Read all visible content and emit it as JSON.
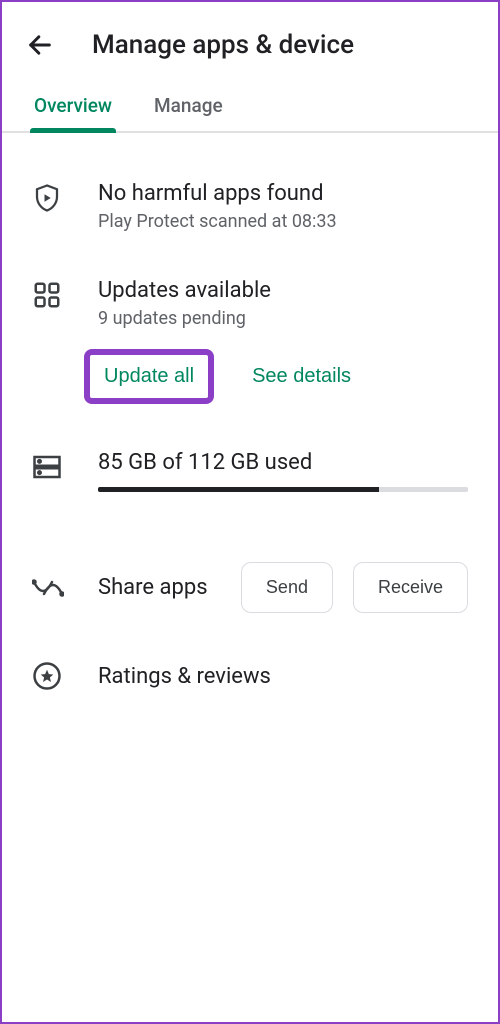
{
  "header": {
    "title": "Manage apps & device"
  },
  "tabs": {
    "overview": "Overview",
    "manage": "Manage"
  },
  "protect": {
    "title": "No harmful apps found",
    "subtitle": "Play Protect scanned at 08:33"
  },
  "updates": {
    "title": "Updates available",
    "subtitle": "9 updates pending",
    "update_all": "Update all",
    "see_details": "See details"
  },
  "storage": {
    "text": "85 GB of 112 GB used",
    "percent": 76
  },
  "share": {
    "title": "Share apps",
    "send": "Send",
    "receive": "Receive"
  },
  "ratings": {
    "title": "Ratings & reviews"
  }
}
